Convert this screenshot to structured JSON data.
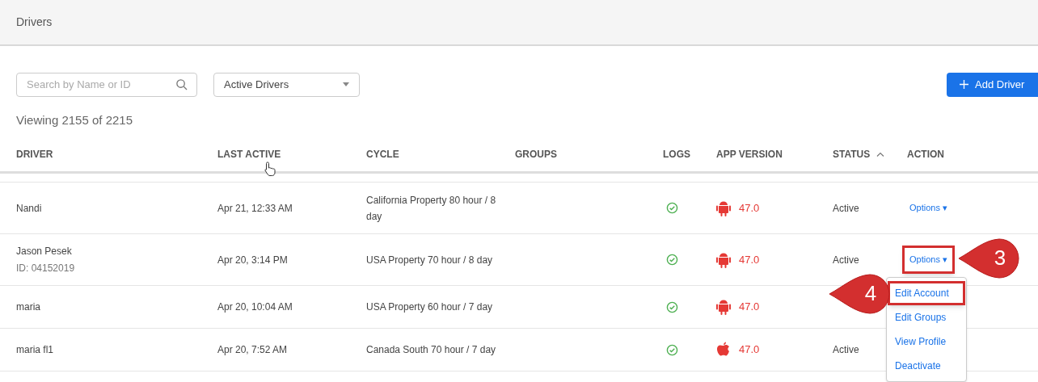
{
  "page_title": "Drivers",
  "search": {
    "placeholder": "Search by Name or ID"
  },
  "filter": {
    "value": "Active Drivers"
  },
  "add_button": "Add Driver",
  "viewing": "Viewing 2155 of 2215",
  "columns": [
    {
      "label": "DRIVER",
      "sorted": false
    },
    {
      "label": "LAST ACTIVE",
      "sorted": false
    },
    {
      "label": "CYCLE",
      "sorted": false
    },
    {
      "label": "GROUPS",
      "sorted": false
    },
    {
      "label": "LOGS",
      "sorted": false
    },
    {
      "label": "APP VERSION",
      "sorted": false
    },
    {
      "label": "STATUS",
      "sorted": true
    },
    {
      "label": "ACTION",
      "sorted": false
    }
  ],
  "rows": [
    {
      "name": "Nandi",
      "last_active": "Apr 21, 12:33 AM",
      "cycle": "California Property 80 hour / 8 day",
      "logs_ok": true,
      "kind": "android",
      "version": "47.0",
      "status": "Active",
      "action": "Options ▾",
      "highlighted": false
    },
    {
      "name": "Jason Pesek",
      "id": "ID: 04152019",
      "last_active": "Apr 20, 3:14 PM",
      "cycle": "USA Property 70 hour / 8 day",
      "logs_ok": true,
      "kind": "android",
      "version": "47.0",
      "status": "Active",
      "action": "Options ▾",
      "highlighted": true
    },
    {
      "name": "maria",
      "last_active": "Apr 20, 10:04 AM",
      "cycle": "USA Property 60 hour / 7 day",
      "logs_ok": true,
      "kind": "android",
      "version": "47.0"
    },
    {
      "name": "maria fl1",
      "last_active": "Apr 20, 7:52 AM",
      "cycle": "Canada South 70 hour / 7 day",
      "logs_ok": true,
      "kind": "apple",
      "version": "47.0",
      "status": "Active"
    }
  ],
  "menu": {
    "items": [
      {
        "label": "Edit Account",
        "highlighted": true
      },
      {
        "label": "Edit Groups",
        "highlighted": false
      },
      {
        "label": "View Profile",
        "highlighted": false
      },
      {
        "label": "Deactivate",
        "highlighted": false
      }
    ]
  },
  "callouts": [
    {
      "number": "3"
    },
    {
      "number": "4"
    }
  ]
}
